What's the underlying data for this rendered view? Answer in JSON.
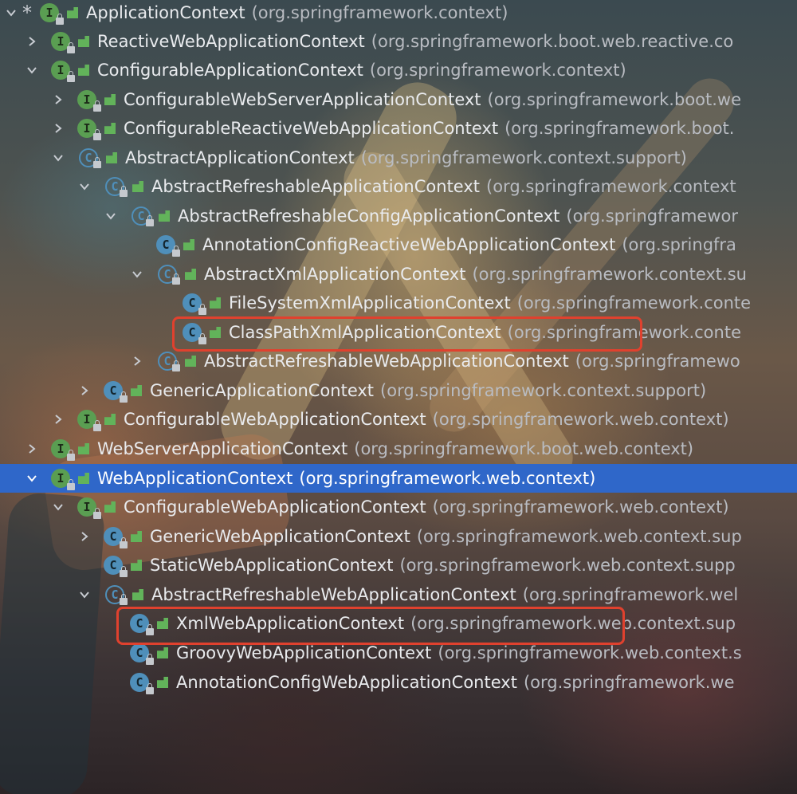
{
  "rows": [
    {
      "name": "ApplicationContext",
      "pkg": "(org.springframework.context)"
    },
    {
      "name": "ReactiveWebApplicationContext",
      "pkg": "(org.springframework.boot.web.reactive.co"
    },
    {
      "name": "ConfigurableApplicationContext",
      "pkg": "(org.springframework.context)"
    },
    {
      "name": "ConfigurableWebServerApplicationContext",
      "pkg": "(org.springframework.boot.we"
    },
    {
      "name": "ConfigurableReactiveWebApplicationContext",
      "pkg": "(org.springframework.boot."
    },
    {
      "name": "AbstractApplicationContext",
      "pkg": "(org.springframework.context.support)"
    },
    {
      "name": "AbstractRefreshableApplicationContext",
      "pkg": "(org.springframework.context"
    },
    {
      "name": "AbstractRefreshableConfigApplicationContext",
      "pkg": "(org.springframewor"
    },
    {
      "name": "AnnotationConfigReactiveWebApplicationContext",
      "pkg": "(org.springfra"
    },
    {
      "name": "AbstractXmlApplicationContext",
      "pkg": "(org.springframework.context.su"
    },
    {
      "name": "FileSystemXmlApplicationContext",
      "pkg": "(org.springframework.conte"
    },
    {
      "name": "ClassPathXmlApplicationContext",
      "pkg": "(org.springframework.conte"
    },
    {
      "name": "AbstractRefreshableWebApplicationContext",
      "pkg": "(org.springframewo"
    },
    {
      "name": "GenericApplicationContext",
      "pkg": "(org.springframework.context.support)"
    },
    {
      "name": "ConfigurableWebApplicationContext",
      "pkg": "(org.springframework.web.context)"
    },
    {
      "name": "WebServerApplicationContext",
      "pkg": "(org.springframework.boot.web.context)"
    },
    {
      "name": "WebApplicationContext",
      "pkg": "(org.springframework.web.context)"
    },
    {
      "name": "ConfigurableWebApplicationContext",
      "pkg": "(org.springframework.web.context)"
    },
    {
      "name": "GenericWebApplicationContext",
      "pkg": "(org.springframework.web.context.sup"
    },
    {
      "name": "StaticWebApplicationContext",
      "pkg": "(org.springframework.web.context.supp"
    },
    {
      "name": "AbstractRefreshableWebApplicationContext",
      "pkg": "(org.springframework.wel"
    },
    {
      "name": "XmlWebApplicationContext",
      "pkg": "(org.springframework.web.context.sup"
    },
    {
      "name": "GroovyWebApplicationContext",
      "pkg": "(org.springframework.web.context.s"
    },
    {
      "name": "AnnotationConfigWebApplicationContext",
      "pkg": "(org.springframework.we"
    }
  ],
  "icons": {
    "interface_letter": "I",
    "class_letter": "C",
    "root_marker": "*"
  },
  "colors": {
    "selection": "#2f67c9",
    "highlight": "#e0412e",
    "interface_icon": "#5a9e52",
    "class_icon": "#4f8fba"
  }
}
